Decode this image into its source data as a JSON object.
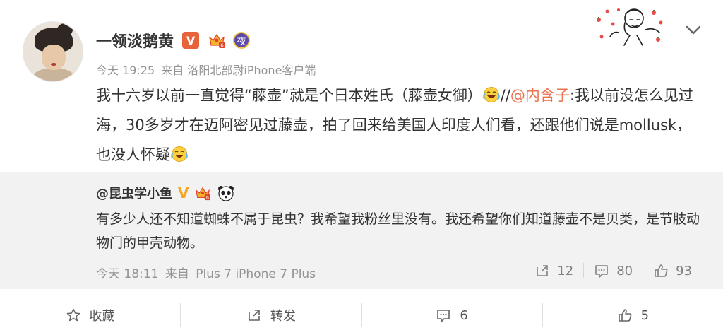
{
  "post": {
    "author": "一领淡鹅黄",
    "badge_v": "V",
    "badge_night": "夜",
    "time": "今天 19:25",
    "source_prefix": "来自",
    "source": "洛阳北部尉iPhone客户端",
    "content_part1": "我十六岁以前一直觉得“藤壶”就是个日本姓氏（藤壶女御）",
    "content_sep": "//",
    "mention": "@内含子",
    "content_part2": ":我以前没怎么见过海，30多岁才在迈阿密见过藤壶，拍了回来给美国人印度人们看，还跟他们说是mollusk，也没人怀疑",
    "emoji1": "laughing-crying-emoji",
    "emoji2": "laughing-crying-emoji"
  },
  "repost": {
    "author": "@昆虫学小鱼",
    "badge_v": "V",
    "text": "有多少人还不知道蜘蛛不属于昆虫？我希望我粉丝里没有。我还希望你们知道藤壶不是贝类，是节肢动物门的甲壳动物。",
    "time": "今天 18:11",
    "source_prefix": "来自",
    "source": "Plus 7 iPhone 7 Plus",
    "reposts": "12",
    "comments": "80",
    "likes": "93"
  },
  "actions": {
    "favorite": "收藏",
    "repost": "转发",
    "comment_count": "6",
    "like_count": "5"
  },
  "colors": {
    "mention": "#eb7350",
    "badge_v": "#e8633a",
    "repost_bg": "#f2f2f2",
    "meta": "#939393"
  }
}
